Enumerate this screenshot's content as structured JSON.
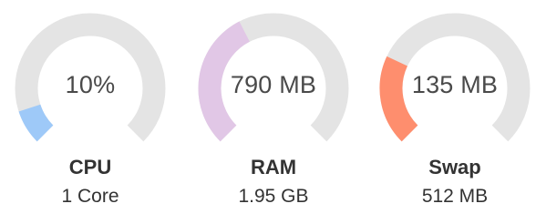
{
  "colors": {
    "track": "#e4e4e4",
    "cpu": "#9ec9f8",
    "ram": "#e1c7e6",
    "swap": "#fe8e6e",
    "text": "#333333"
  },
  "gauges": [
    {
      "id": "cpu",
      "value_label": "10%",
      "name": "CPU",
      "sub": "1 Core",
      "fill_fraction": 0.1,
      "color": "#9ec9f8"
    },
    {
      "id": "ram",
      "value_label": "790 MB",
      "name": "RAM",
      "sub": "1.95 GB",
      "fill_fraction": 0.4,
      "color": "#e1c7e6"
    },
    {
      "id": "swap",
      "value_label": "135 MB",
      "name": "Swap",
      "sub": "512 MB",
      "fill_fraction": 0.26,
      "color": "#fe8e6e"
    }
  ]
}
